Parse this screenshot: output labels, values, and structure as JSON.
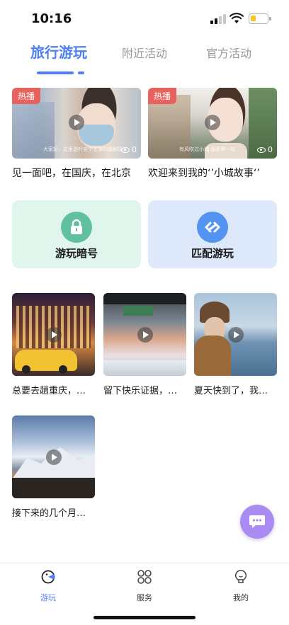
{
  "status_bar": {
    "time": "10:16"
  },
  "tabs": [
    {
      "label": "旅行游玩",
      "active": true
    },
    {
      "label": "附近活动",
      "active": false
    },
    {
      "label": "官方活动",
      "active": false
    }
  ],
  "featured": [
    {
      "badge": "热播",
      "views": "0",
      "title": "见一面吧，在国庆，在北京",
      "caption": "大家好，这里是叶安宁主演的微剧场"
    },
    {
      "badge": "热播",
      "views": "0",
      "title": "欢迎来到我的‘’小城故事‘’",
      "caption": "有风吹过小城 温柔第一站"
    }
  ],
  "actions": [
    {
      "label": "游玩暗号",
      "icon": "lock-icon",
      "color": "#5fc1a0"
    },
    {
      "label": "匹配游玩",
      "icon": "link-icon",
      "color": "#5393f1"
    }
  ],
  "videos": [
    {
      "title": "总要去趟重庆，…"
    },
    {
      "title": "留下快乐证据，…"
    },
    {
      "title": "夏天快到了，我…"
    },
    {
      "title": "接下来的几个月…"
    }
  ],
  "bottom_nav": [
    {
      "label": "游玩",
      "icon": "play-face-icon",
      "active": true
    },
    {
      "label": "服务",
      "icon": "grid-circles-icon",
      "active": false
    },
    {
      "label": "我的",
      "icon": "profile-icon",
      "active": false
    }
  ],
  "colors": {
    "accent": "#4f7ff6",
    "hot_badge": "#e8615c",
    "fab": "#a98bf2"
  }
}
